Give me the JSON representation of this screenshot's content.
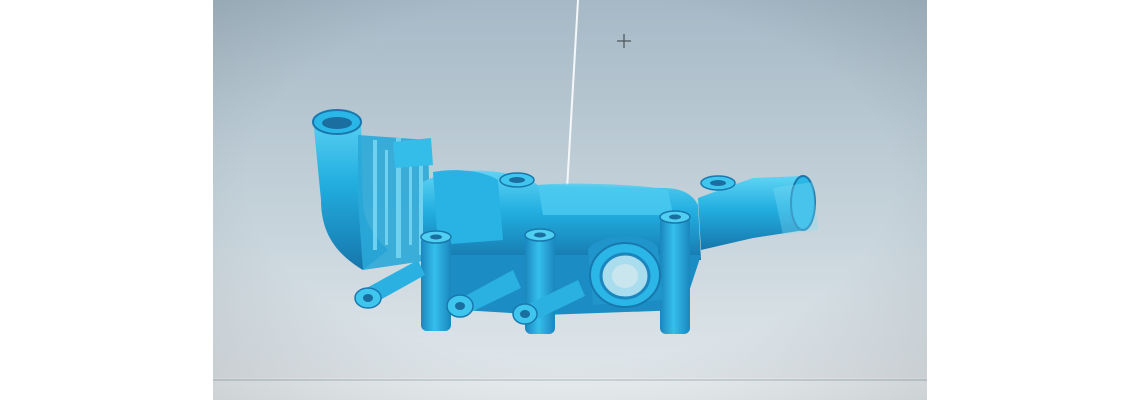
{
  "image": {
    "kind": "photo-of-monitor",
    "subject_icon": "3d-scan-mesh-icon",
    "colors": {
      "viewport_bg_top": "#a9bcc8",
      "viewport_bg_bottom": "#dfe6ea",
      "mesh_main": "#1ea8d8",
      "mesh_dark": "#1574a8",
      "mesh_light": "#5fd2f2",
      "cursor": "#555555",
      "scan_line": "#f4f8fa"
    }
  }
}
